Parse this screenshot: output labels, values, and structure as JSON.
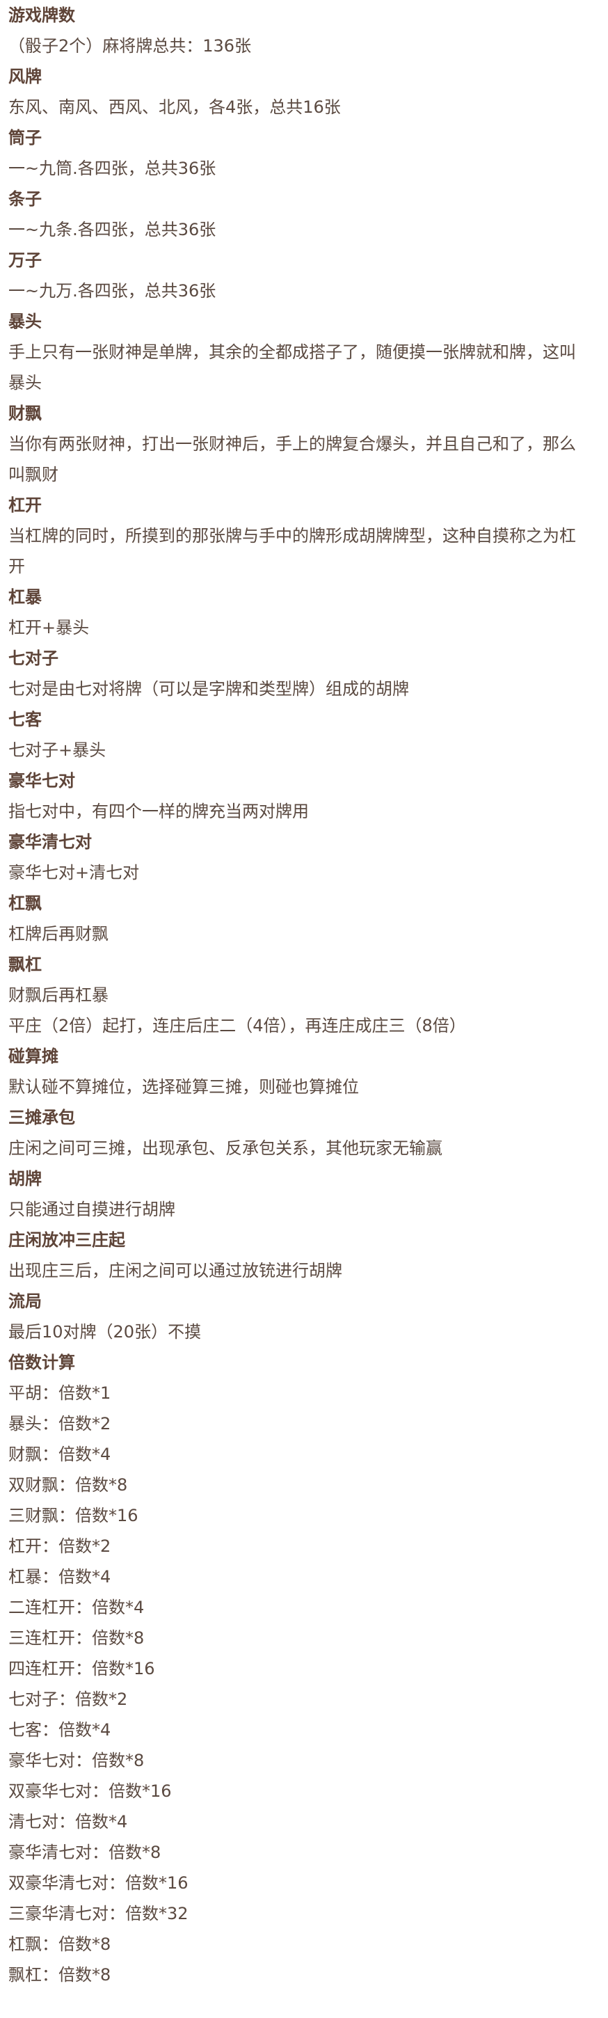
{
  "sections": [
    {
      "title": "游戏牌数",
      "lines": [
        "（骰子2个）麻将牌总共：136张"
      ]
    },
    {
      "title": "风牌",
      "lines": [
        "东风、南风、西风、北风，各4张，总共16张"
      ]
    },
    {
      "title": "筒子",
      "lines": [
        "一~九筒.各四张，总共36张"
      ]
    },
    {
      "title": "条子",
      "lines": [
        "一~九条.各四张，总共36张"
      ]
    },
    {
      "title": "万子",
      "lines": [
        "一~九万.各四张，总共36张"
      ]
    },
    {
      "title": "暴头",
      "lines": [
        "手上只有一张财神是单牌，其余的全都成搭子了，随便摸一张牌就和牌，这叫",
        "暴头"
      ]
    },
    {
      "title": "财飘",
      "lines": [
        "当你有两张财神，打出一张财神后，手上的牌复合爆头，并且自己和了，那么",
        "叫飘财"
      ]
    },
    {
      "title": "杠开",
      "lines": [
        "当杠牌的同时，所摸到的那张牌与手中的牌形成胡牌牌型，这种自摸称之为杠",
        "开"
      ]
    },
    {
      "title": "杠暴",
      "lines": [
        "杠开+暴头"
      ]
    },
    {
      "title": "七对子",
      "lines": [
        "七对是由七对将牌（可以是字牌和类型牌）组成的胡牌"
      ]
    },
    {
      "title": "七客",
      "lines": [
        "七对子+暴头"
      ]
    },
    {
      "title": "豪华七对",
      "lines": [
        "指七对中，有四个一样的牌充当两对牌用"
      ]
    },
    {
      "title": "豪华清七对",
      "lines": [
        "豪华七对+清七对"
      ]
    },
    {
      "title": "杠飘",
      "lines": [
        "杠牌后再财飘"
      ]
    },
    {
      "title": "飘杠",
      "lines": [
        "财飘后再杠暴",
        "平庄（2倍）起打，连庄后庄二（4倍），再连庄成庄三（8倍）"
      ]
    },
    {
      "title": "碰算摊",
      "lines": [
        "默认碰不算摊位，选择碰算三摊，则碰也算摊位"
      ]
    },
    {
      "title": "三摊承包",
      "lines": [
        "庄闲之间可三摊，出现承包、反承包关系，其他玩家无输赢"
      ]
    },
    {
      "title": "胡牌",
      "lines": [
        "只能通过自摸进行胡牌"
      ]
    },
    {
      "title": "庄闲放冲三庄起",
      "lines": [
        "出现庄三后，庄闲之间可以通过放铳进行胡牌"
      ]
    },
    {
      "title": "流局",
      "lines": [
        "最后10对牌（20张）不摸"
      ]
    },
    {
      "title": "倍数计算",
      "lines": [
        "平胡：倍数*1",
        "暴头：倍数*2",
        "财飘：倍数*4",
        "双财飘：倍数*8",
        "三财飘：倍数*16",
        "杠开：倍数*2",
        "杠暴：倍数*4",
        "二连杠开：倍数*4",
        "三连杠开：倍数*8",
        "四连杠开：倍数*16",
        "七对子：倍数*2",
        "七客：倍数*4",
        "豪华七对：倍数*8",
        "双豪华七对：倍数*16",
        "清七对：倍数*4",
        "豪华清七对：倍数*8",
        "双豪华清七对：倍数*16",
        "三豪华清七对：倍数*32",
        "杠飘：倍数*8",
        "飘杠：倍数*8"
      ]
    }
  ]
}
